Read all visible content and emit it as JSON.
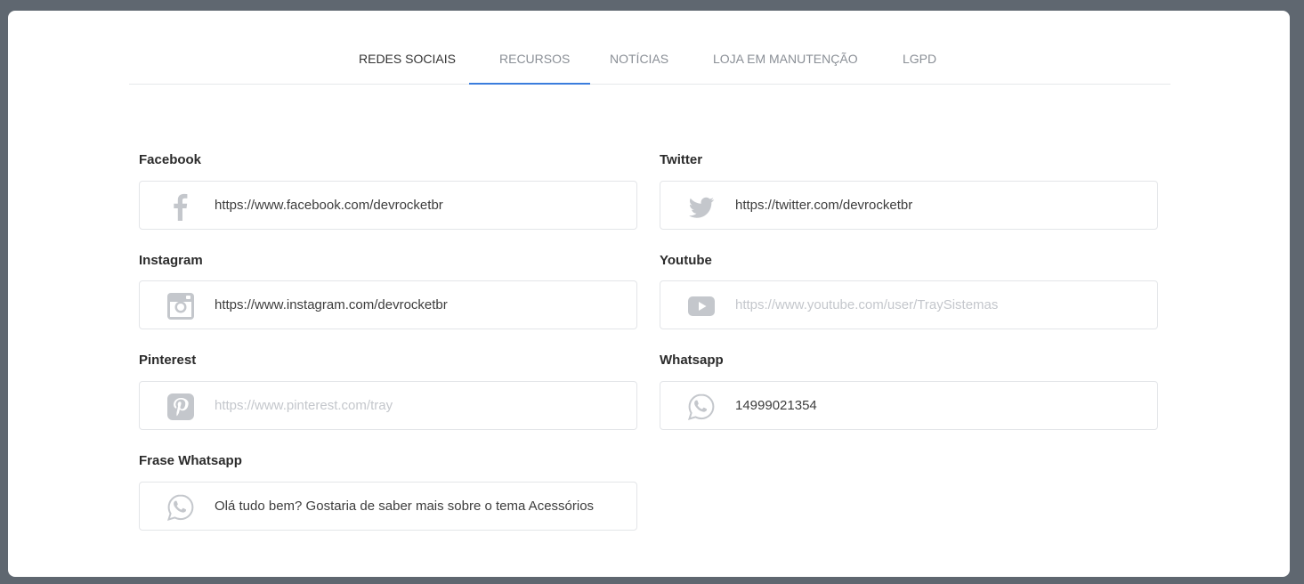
{
  "tabs": [
    {
      "label": "REDES SOCIAIS",
      "active": true
    },
    {
      "label": "RECURSOS",
      "active": false
    },
    {
      "label": "NOTÍCIAS",
      "active": false
    },
    {
      "label": "LOJA EM MANUTENÇÃO",
      "active": false
    },
    {
      "label": "LGPD",
      "active": false
    }
  ],
  "fields": {
    "facebook": {
      "label": "Facebook",
      "value": "https://www.facebook.com/devrocketbr",
      "icon": "facebook-icon"
    },
    "twitter": {
      "label": "Twitter",
      "value": "https://twitter.com/devrocketbr",
      "icon": "twitter-icon"
    },
    "instagram": {
      "label": "Instagram",
      "value": "https://www.instagram.com/devrocketbr",
      "icon": "instagram-icon"
    },
    "youtube": {
      "label": "Youtube",
      "placeholder": "https://www.youtube.com/user/TraySistemas",
      "icon": "youtube-icon"
    },
    "pinterest": {
      "label": "Pinterest",
      "placeholder": "https://www.pinterest.com/tray",
      "icon": "pinterest-icon"
    },
    "whatsapp": {
      "label": "Whatsapp",
      "value": "14999021354",
      "icon": "whatsapp-icon"
    },
    "frase_whatsapp": {
      "label": "Frase Whatsapp",
      "value": "Olá tudo bem? Gostaria de saber mais sobre o tema Acessórios",
      "icon": "whatsapp-icon"
    }
  },
  "colors": {
    "accent": "#3b7ddd",
    "icon": "#c4c7cc",
    "background": "#5f6770"
  }
}
